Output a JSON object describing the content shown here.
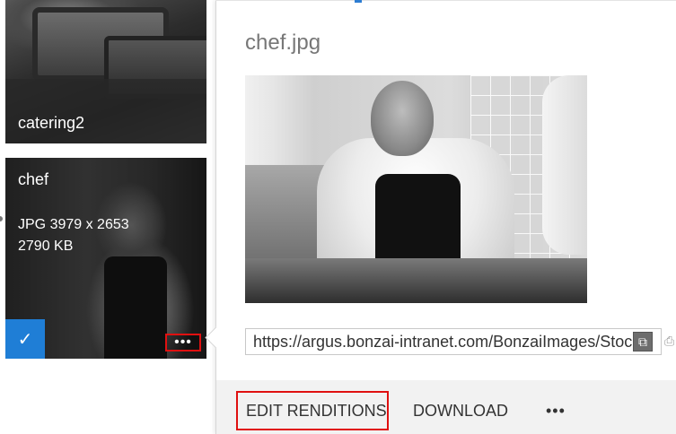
{
  "tiles": [
    {
      "name": "catering2"
    },
    {
      "name": "chef",
      "meta_line1": "JPG 3979 x 2653",
      "meta_line2": "2790 KB",
      "more_label": "•••",
      "selected": true,
      "check_glyph": "✓"
    }
  ],
  "panel": {
    "title": "chef.jpg",
    "url": "https://argus.bonzai-intranet.com/BonzaiImages/Stoc",
    "actions": {
      "edit_renditions": "EDIT RENDITIONS",
      "download": "DOWNLOAD",
      "more": "•••"
    }
  },
  "colors": {
    "accent": "#1f7ed6",
    "highlight_box": "#e01010",
    "footer_bg": "#f2f2f2"
  }
}
